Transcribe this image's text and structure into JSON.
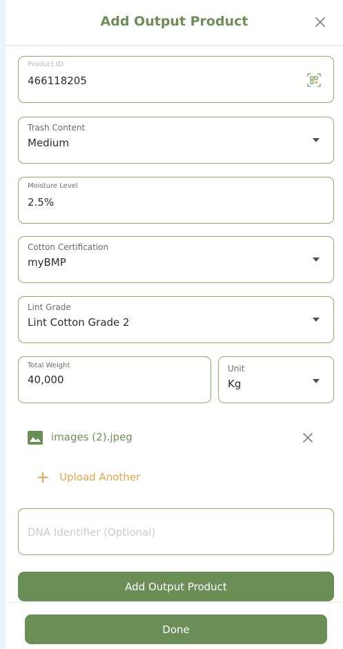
{
  "header": {
    "title": "Add Output Product"
  },
  "fields": {
    "product_id": {
      "label": "Product ID",
      "value": "466118205"
    },
    "trash_content": {
      "label": "Trash Content",
      "value": "Medium"
    },
    "moisture_level": {
      "label": "Moisture Level",
      "value": "2.5%"
    },
    "cotton_certification": {
      "label": "Cotton Certification",
      "value": "myBMP"
    },
    "lint_grade": {
      "label": "Lint Grade",
      "value": "Lint Cotton Grade 2"
    },
    "total_weight": {
      "label": "Total Weight",
      "value": "40,000"
    },
    "unit": {
      "label": "Unit",
      "value": "Kg"
    },
    "dna_identifier": {
      "placeholder": "DNA Identifier (Optional)",
      "value": ""
    }
  },
  "attachment": {
    "file_name": "images (2).jpeg"
  },
  "upload": {
    "label": "Upload Another"
  },
  "buttons": {
    "add_output_product": "Add Output Product",
    "done": "Done"
  },
  "colors": {
    "brand_green": "#6b8e57",
    "border_green": "#86ab6c",
    "accent_orange": "#e2a64a"
  },
  "icons": [
    "close-icon",
    "qr-scan-icon",
    "dropdown-caret-icon",
    "image-file-icon",
    "remove-file-icon",
    "plus-icon"
  ]
}
